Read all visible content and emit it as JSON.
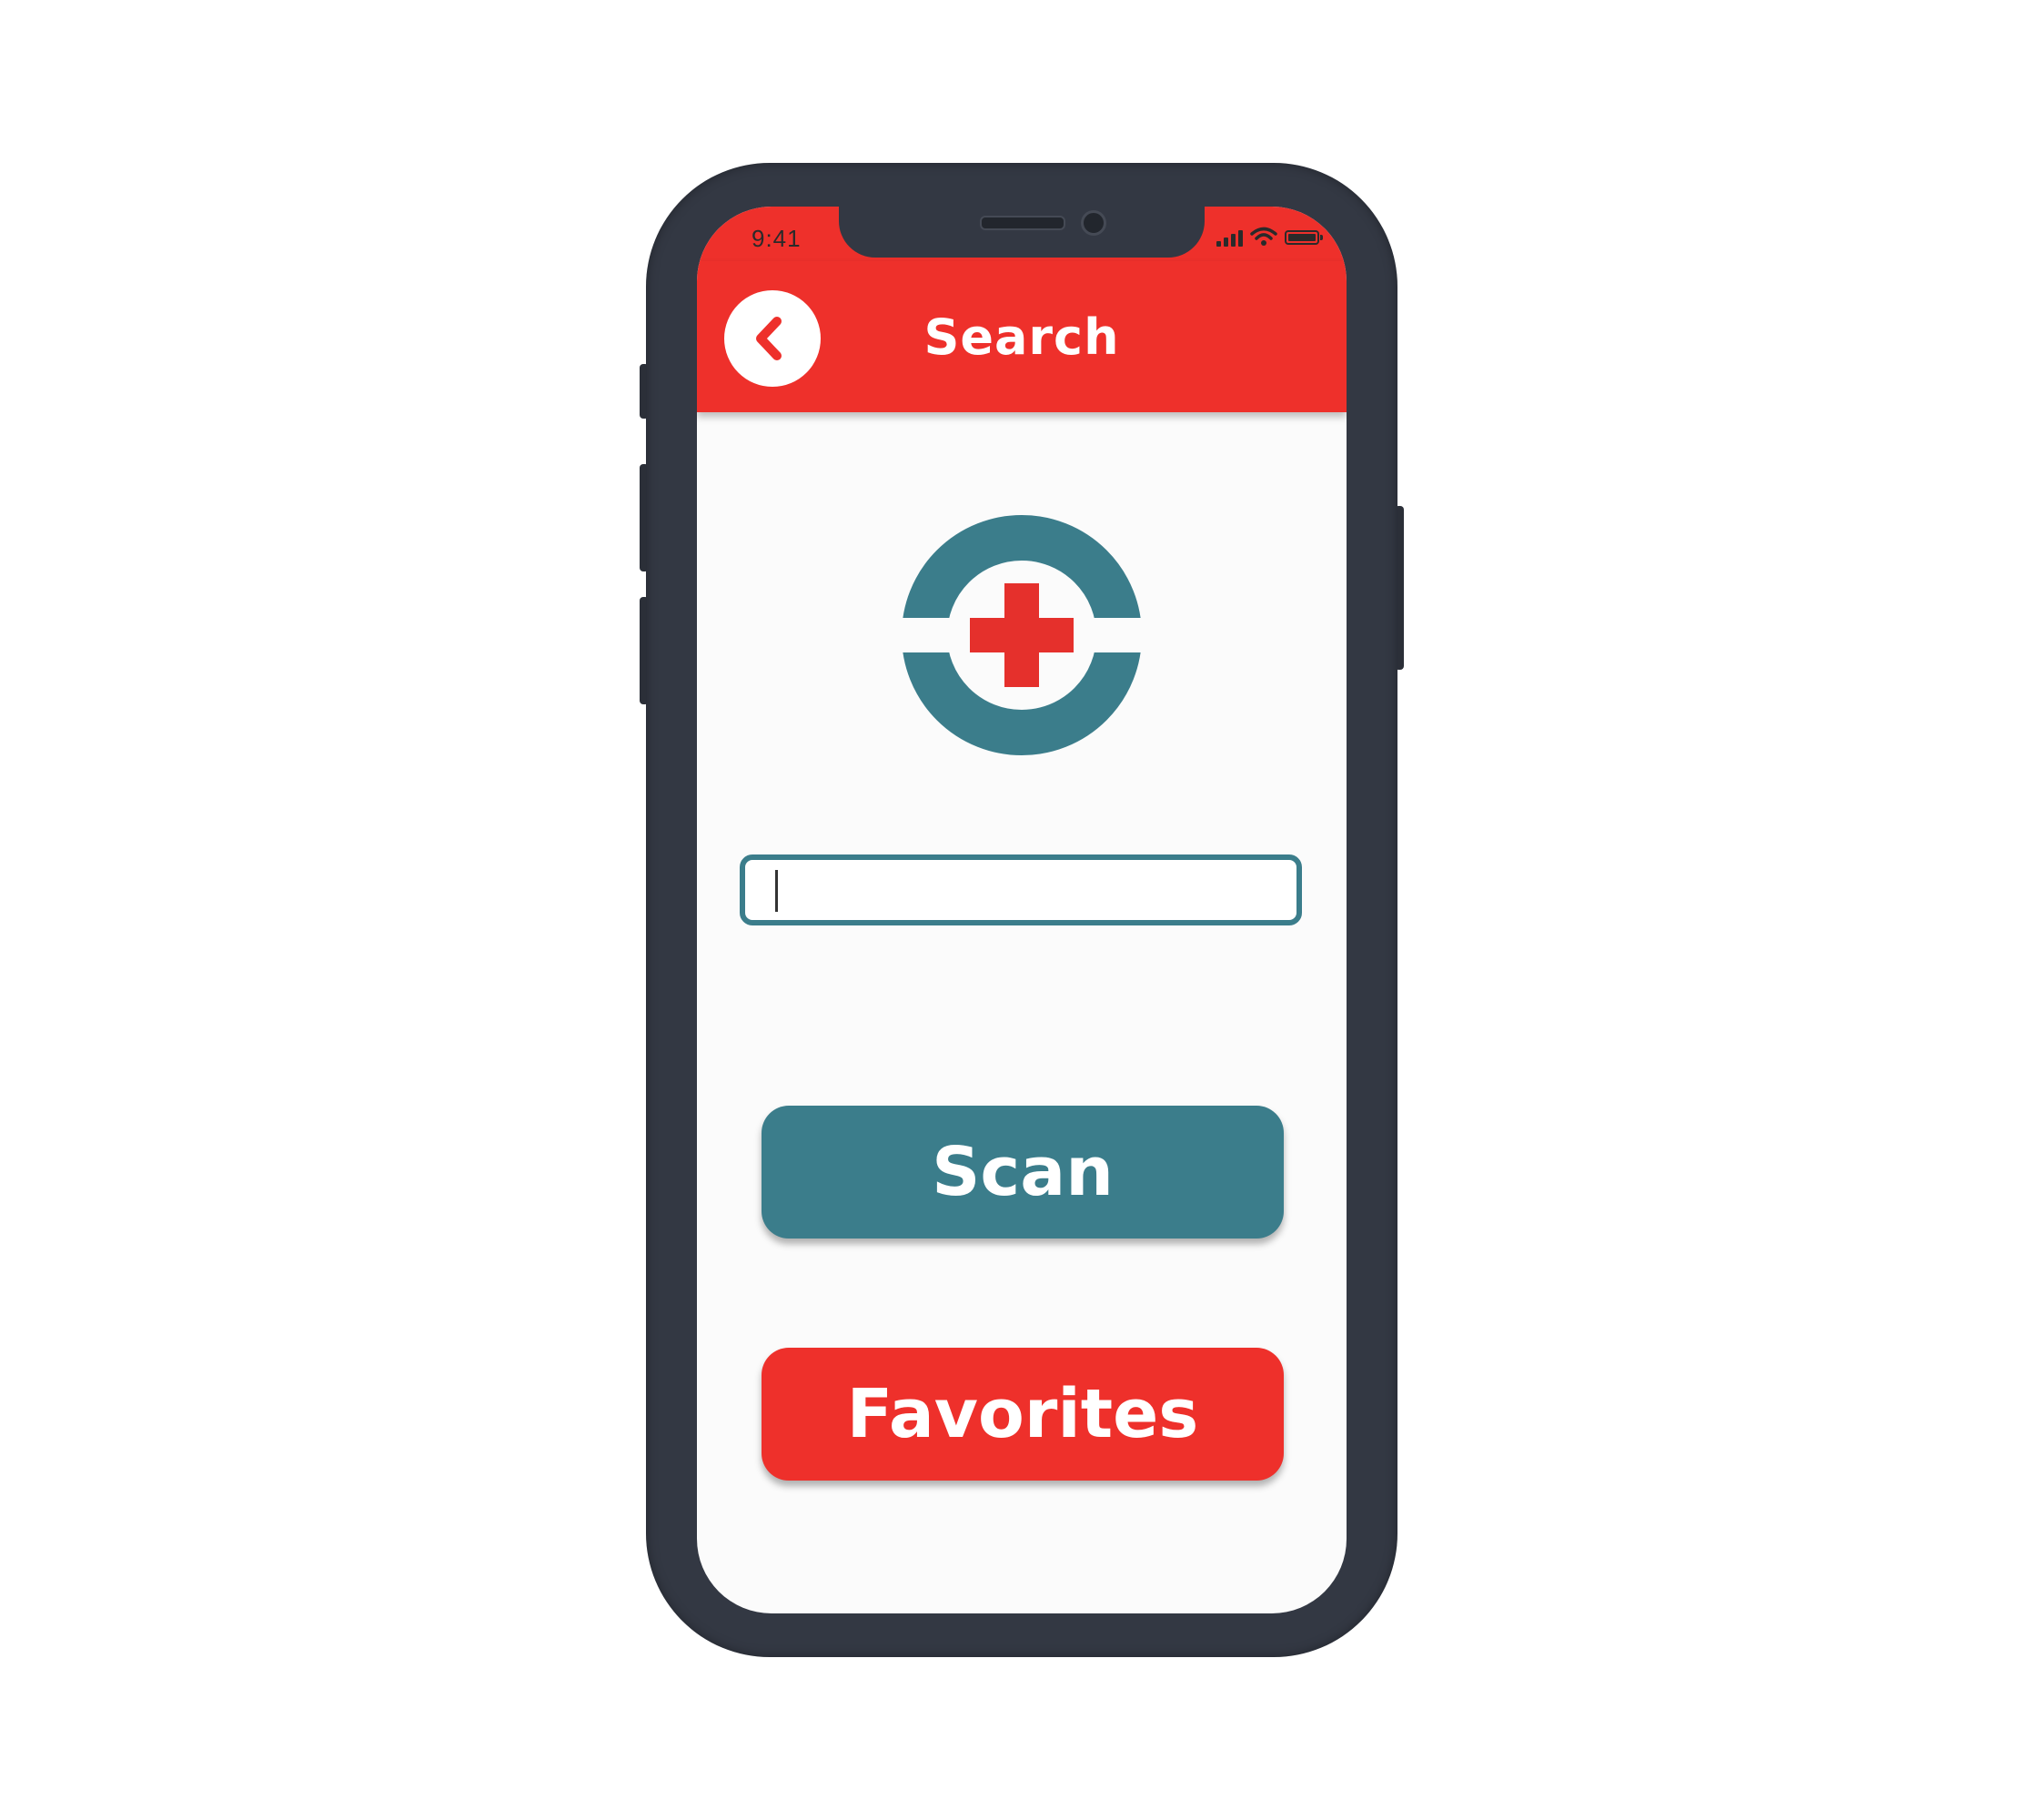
{
  "status_bar": {
    "time": "9:41",
    "icons": [
      "cellular-signal-icon",
      "wifi-icon",
      "battery-icon"
    ]
  },
  "header": {
    "title": "Search",
    "back_icon": "chevron-left-icon"
  },
  "logo": {
    "icon": "medical-cross-logo-icon"
  },
  "search": {
    "value": "",
    "placeholder": ""
  },
  "buttons": {
    "scan_label": "Scan",
    "favorites_label": "Favorites"
  },
  "colors": {
    "accent_red": "#ee302b",
    "accent_teal": "#3b7d8b",
    "screen_background": "#fbfbfb",
    "device_body": "#333843"
  }
}
